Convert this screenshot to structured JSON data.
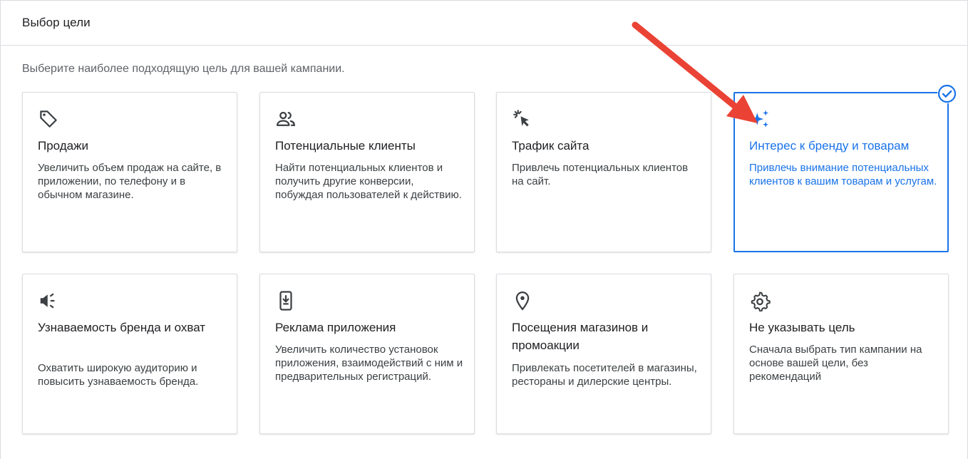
{
  "header": {
    "title": "Выбор цели"
  },
  "subtitle": "Выберите наиболее подходящую цель для вашей кампании.",
  "cards": [
    {
      "title": "Продажи",
      "description": "Увеличить объем продаж на сайте, в приложении, по телефону и в обычном магазине.",
      "icon": "tag-icon",
      "selected": false
    },
    {
      "title": "Потенциальные клиенты",
      "description": "Найти потенциальных клиентов и получить другие конверсии, побуждая пользователей к действию.",
      "icon": "people-icon",
      "selected": false
    },
    {
      "title": "Трафик сайта",
      "description": "Привлечь потенциальных клиентов на сайт.",
      "icon": "cursor-click-icon",
      "selected": false
    },
    {
      "title": "Интерес к бренду и товарам",
      "description": "Привлечь внимание потенциальных клиентов к вашим товарам и услугам.",
      "icon": "sparkle-icon",
      "selected": true
    },
    {
      "title": "Узнаваемость бренда и охват",
      "description": "Охватить широкую аудиторию и повысить узнаваемость бренда.",
      "icon": "megaphone-icon",
      "selected": false
    },
    {
      "title": "Реклама приложения",
      "description": "Увеличить количество установок приложения, взаимодействий с ним и предварительных регистраций.",
      "icon": "phone-download-icon",
      "selected": false
    },
    {
      "title": "Посещения магазинов и промоакции",
      "description": "Привлекать посетителей в магазины, рестораны и дилерские центры.",
      "icon": "location-pin-icon",
      "selected": false
    },
    {
      "title": "Не указывать цель",
      "description": "Сначала выбрать тип кампании на основе вашей цели, без рекомендаций",
      "icon": "gear-icon",
      "selected": false
    }
  ],
  "colors": {
    "accent": "#1a73e8",
    "arrow": "#ea4335",
    "border": "#dadce0"
  }
}
